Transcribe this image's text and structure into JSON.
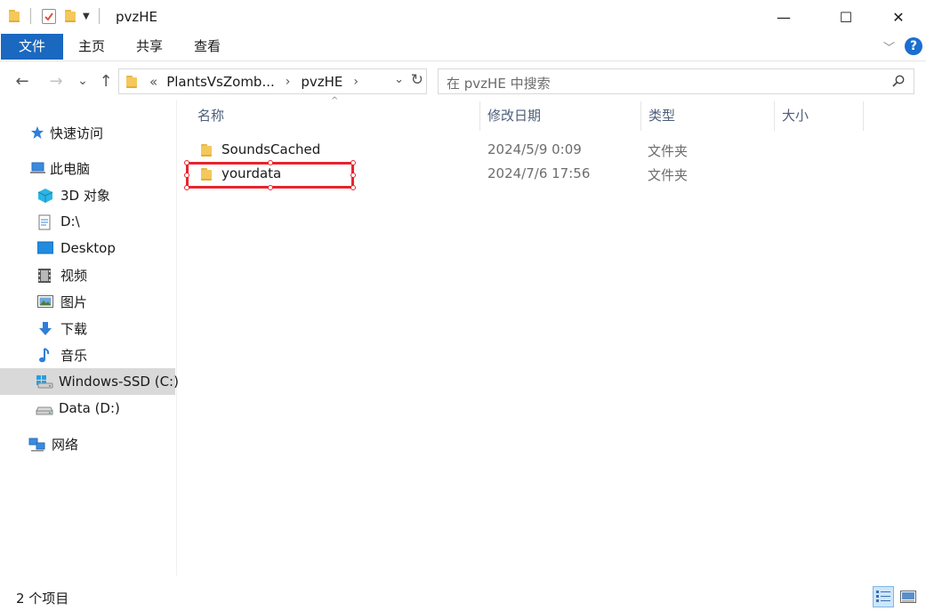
{
  "window": {
    "title": "pvzHE",
    "minimize_glyph": "—",
    "maximize_glyph": "☐",
    "close_glyph": "✕"
  },
  "ribbon": {
    "tabs": [
      "文件",
      "主页",
      "共享",
      "查看"
    ],
    "help_glyph": "?",
    "expand_glyph": "﹀"
  },
  "nav": {
    "back_glyph": "←",
    "forward_glyph": "→",
    "recent_glyph": "⌄",
    "up_glyph": "↑",
    "address": {
      "overflow": "«",
      "crumbs": [
        "PlantsVsZomb...",
        "pvzHE"
      ],
      "separator": "›",
      "dropdown_glyph": "⌄",
      "refresh_glyph": "↻"
    },
    "search_placeholder": "在 pvzHE 中搜索"
  },
  "sidebar": {
    "items": [
      {
        "label": "快速访问",
        "icon": "star-icon"
      },
      {
        "label": "此电脑",
        "icon": "computer-icon"
      },
      {
        "label": "3D 对象",
        "icon": "cube-icon"
      },
      {
        "label": "D:\\",
        "icon": "document-icon"
      },
      {
        "label": "Desktop",
        "icon": "desktop-icon"
      },
      {
        "label": "视频",
        "icon": "video-icon"
      },
      {
        "label": "图片",
        "icon": "picture-icon"
      },
      {
        "label": "下载",
        "icon": "download-icon"
      },
      {
        "label": "音乐",
        "icon": "music-icon"
      },
      {
        "label": "Windows-SSD (C:)",
        "icon": "windows-drive-icon",
        "selected": true
      },
      {
        "label": "Data (D:)",
        "icon": "drive-icon"
      },
      {
        "label": "网络",
        "icon": "network-icon"
      }
    ]
  },
  "columns": [
    "名称",
    "修改日期",
    "类型",
    "大小"
  ],
  "sort_glyph": "^",
  "files": [
    {
      "name": "SoundsCached",
      "date": "2024/5/9 0:09",
      "type": "文件夹",
      "size": ""
    },
    {
      "name": "yourdata",
      "date": "2024/7/6 17:56",
      "type": "文件夹",
      "size": ""
    }
  ],
  "status": {
    "item_count": "2 个项目"
  },
  "colors": {
    "file_tab": "#1a68c0",
    "folder": "#f4c85b",
    "annotation": "#e8242d",
    "selected_bg": "#d9d9d9"
  }
}
